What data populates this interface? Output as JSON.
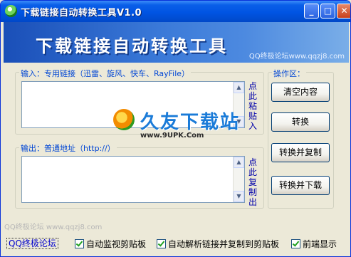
{
  "window": {
    "title": "下载链接自动转换工具V1.0",
    "minimize_glyph": "_",
    "maximize_glyph": "□",
    "close_glyph": "✕"
  },
  "banner": {
    "title": "下载链接自动转换工具",
    "site": "QQ终极论坛www.qqzj8.com"
  },
  "input_group": {
    "label": "输入：专用链接（迅雷、旋风、快车、RayFile）",
    "value": "",
    "side_link": "点此粘贴入"
  },
  "output_group": {
    "label": "输出：普通地址（http://）",
    "value": "",
    "side_link": "点此复制出"
  },
  "operations": {
    "label": "操作区：",
    "buttons": [
      "清空内容",
      "转换",
      "转换并复制",
      "转换并下载"
    ]
  },
  "watermark": {
    "text": "久友下载站",
    "url": "www.9UPK.Com"
  },
  "footer": {
    "site_url": "QQ终极论坛 www.qqzj8.com",
    "forum_link": "QQ终极论坛",
    "checkboxes": [
      {
        "label": "自动监视剪贴板",
        "checked": true
      },
      {
        "label": "自动解析链接并复制到剪贴板",
        "checked": true
      },
      {
        "label": "前端显示",
        "checked": true
      }
    ]
  },
  "colors": {
    "titlebar": "#0054e3",
    "label_blue": "#0046d5",
    "link_blue": "#0000cc"
  }
}
